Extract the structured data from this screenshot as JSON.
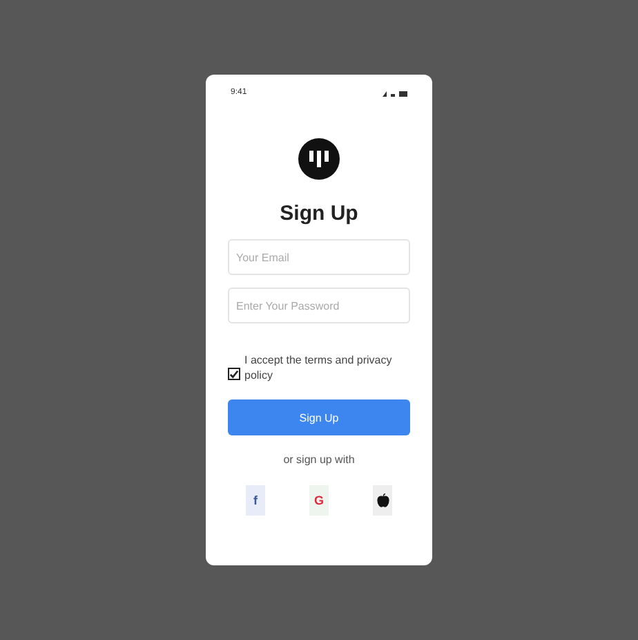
{
  "status_bar": {
    "time": "9:41"
  },
  "title": "Sign Up",
  "fields": [
    {
      "placeholder": "Your Email"
    },
    {
      "placeholder": "Enter Your Password"
    }
  ],
  "terms": {
    "label": "I accept the terms and privacy policy",
    "checked": true
  },
  "submit": "Sign Up",
  "divider_text": "or sign up with",
  "social": [
    {
      "kind": "facebook",
      "label": "f"
    },
    {
      "kind": "google",
      "label": "G"
    },
    {
      "kind": "apple"
    }
  ]
}
